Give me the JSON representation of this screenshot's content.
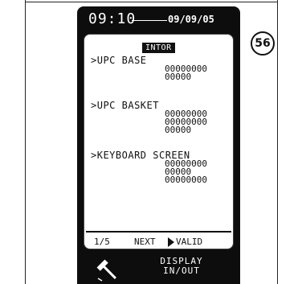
{
  "status_bar": {
    "time": "09:10",
    "date": "09/09/05"
  },
  "screen": {
    "header": "INTOR",
    "sections": [
      {
        "label": ">UPC BASE",
        "values": [
          "00000000",
          "00000"
        ]
      },
      {
        "label": ">UPC BASKET",
        "values": [
          "00000000",
          "00000000",
          "00000"
        ]
      },
      {
        "label": ">KEYBOARD SCREEN",
        "values": [
          "00000000",
          "00000",
          "00000000"
        ]
      }
    ],
    "footer": {
      "page": "1/5",
      "next": "NEXT",
      "valid": "VALID"
    }
  },
  "bottom_button": {
    "line1": "DISPLAY",
    "line2": "IN/OUT",
    "icon": "hammer-icon"
  },
  "figure_number": "56"
}
